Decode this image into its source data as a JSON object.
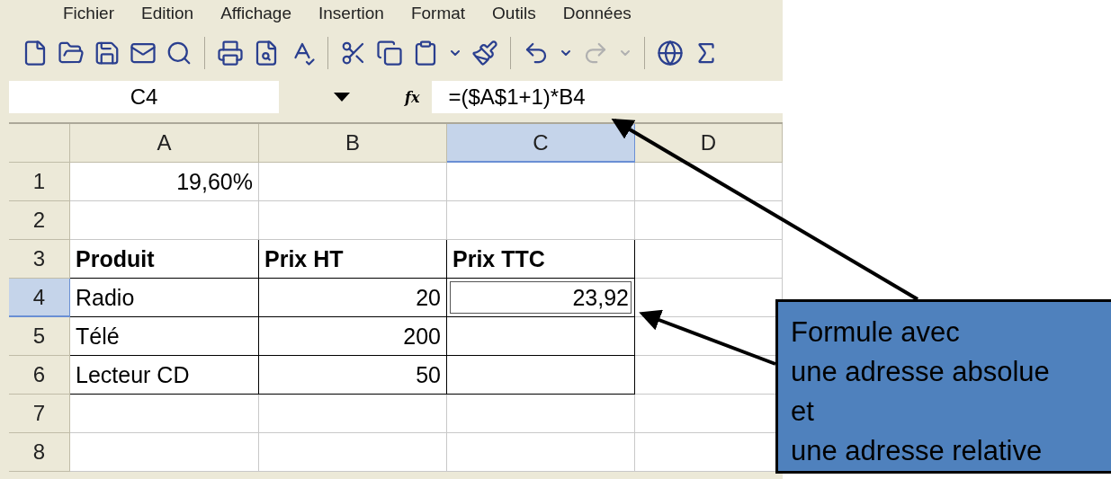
{
  "menu": [
    {
      "label": "Fichier"
    },
    {
      "label": "Edition"
    },
    {
      "label": "Affichage"
    },
    {
      "label": "Insertion"
    },
    {
      "label": "Format"
    },
    {
      "label": "Outils"
    },
    {
      "label": "Données"
    }
  ],
  "toolbar": [
    {
      "kind": "new"
    },
    {
      "kind": "open"
    },
    {
      "kind": "save"
    },
    {
      "kind": "mail"
    },
    {
      "kind": "search"
    },
    {
      "kind": "separator"
    },
    {
      "kind": "print"
    },
    {
      "kind": "preview"
    },
    {
      "kind": "spell"
    },
    {
      "kind": "separator"
    },
    {
      "kind": "cut"
    },
    {
      "kind": "copy"
    },
    {
      "kind": "paste"
    },
    {
      "kind": "dropdown"
    },
    {
      "kind": "brush"
    },
    {
      "kind": "separator"
    },
    {
      "kind": "undo"
    },
    {
      "kind": "dropdown"
    },
    {
      "kind": "redo",
      "disabled": true
    },
    {
      "kind": "dropdown",
      "disabled": true
    },
    {
      "kind": "separator"
    },
    {
      "kind": "globe"
    },
    {
      "kind": "sum"
    }
  ],
  "formula_bar": {
    "name_box": "C4",
    "fx": "fx",
    "formula": "=($A$1+1)*B4"
  },
  "sheet": {
    "columns": [
      {
        "label": "A",
        "selected": false
      },
      {
        "label": "B",
        "selected": false
      },
      {
        "label": "C",
        "selected": true
      },
      {
        "label": "D",
        "selected": false
      }
    ],
    "rows": [
      {
        "label": "1",
        "selected": false,
        "cells": [
          {
            "text": "19,60%",
            "kind": "number"
          },
          {
            "kind": "empty"
          },
          {
            "kind": "empty"
          },
          {
            "kind": "empty"
          }
        ]
      },
      {
        "label": "2",
        "selected": false,
        "cells": [
          {
            "kind": "empty"
          },
          {
            "kind": "empty"
          },
          {
            "kind": "empty"
          },
          {
            "kind": "empty"
          }
        ]
      },
      {
        "label": "3",
        "selected": false,
        "cells": [
          {
            "text": "Produit",
            "kind": "heading",
            "bordered": true
          },
          {
            "text": "Prix HT",
            "kind": "heading",
            "bordered": true
          },
          {
            "text": "Prix TTC",
            "kind": "heading",
            "bordered": true
          },
          {
            "kind": "empty"
          }
        ]
      },
      {
        "label": "4",
        "selected": true,
        "cells": [
          {
            "text": "Radio",
            "kind": "text",
            "bordered": true
          },
          {
            "text": "20",
            "kind": "number",
            "bordered": true
          },
          {
            "text": "23,92",
            "kind": "number",
            "bordered": true,
            "selected": true
          },
          {
            "kind": "empty"
          }
        ]
      },
      {
        "label": "5",
        "selected": false,
        "cells": [
          {
            "text": "Télé",
            "kind": "text",
            "bordered": true
          },
          {
            "text": "200",
            "kind": "number",
            "bordered": true
          },
          {
            "kind": "empty",
            "bordered": true
          },
          {
            "kind": "empty"
          }
        ]
      },
      {
        "label": "6",
        "selected": false,
        "cells": [
          {
            "text": "Lecteur CD",
            "kind": "text",
            "bordered": true
          },
          {
            "text": "50",
            "kind": "number",
            "bordered": true
          },
          {
            "kind": "empty",
            "bordered": true
          },
          {
            "kind": "empty"
          }
        ]
      },
      {
        "label": "7",
        "selected": false,
        "cells": [
          {
            "kind": "empty"
          },
          {
            "kind": "empty"
          },
          {
            "kind": "empty"
          },
          {
            "kind": "empty"
          }
        ]
      },
      {
        "label": "8",
        "selected": false,
        "cells": [
          {
            "kind": "empty"
          },
          {
            "kind": "empty"
          },
          {
            "kind": "empty"
          },
          {
            "kind": "empty"
          }
        ]
      }
    ]
  },
  "callout": {
    "lines": [
      "Formule avec",
      "une adresse absolue",
      "et",
      "une adresse relative"
    ]
  }
}
